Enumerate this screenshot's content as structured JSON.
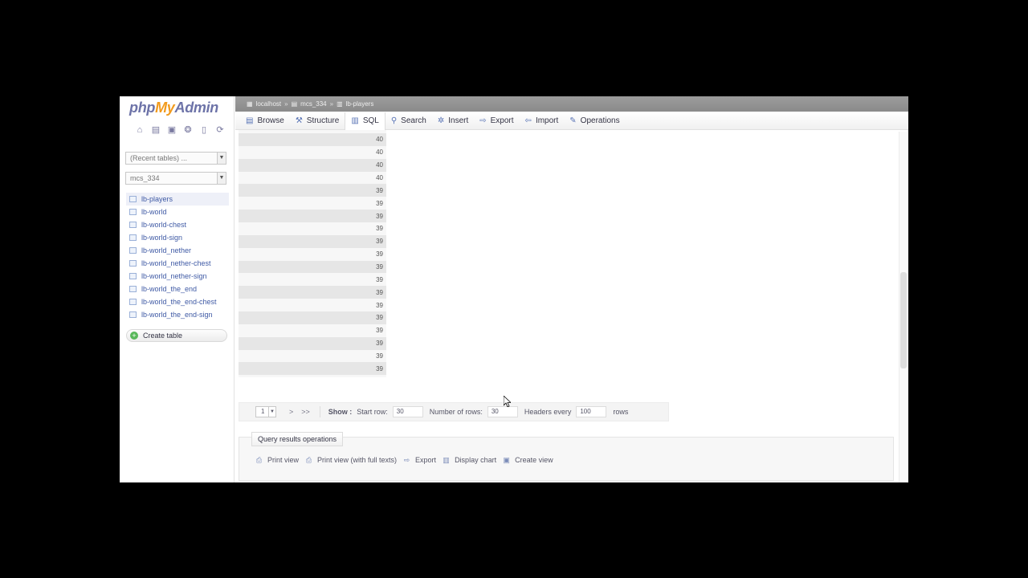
{
  "left_panel": {
    "logo": {
      "part1": "php",
      "part2": "My",
      "part3": "Admin"
    },
    "quick_icons": [
      "home-icon",
      "database-icon",
      "query-icon",
      "docs-icon",
      "copy-icon",
      "reload-icon"
    ],
    "recent_tables": "(Recent tables) ...",
    "database": "mcs_334",
    "tables": [
      "lb-players",
      "lb-world",
      "lb-world-chest",
      "lb-world-sign",
      "lb-world_nether",
      "lb-world_nether-chest",
      "lb-world_nether-sign",
      "lb-world_the_end",
      "lb-world_the_end-chest",
      "lb-world_the_end-sign"
    ],
    "create_table": "Create table"
  },
  "breadcrumb": {
    "server": "localhost",
    "database": "mcs_334",
    "table": "lb-players"
  },
  "tabs": [
    {
      "label": "Browse",
      "icon": "▤"
    },
    {
      "label": "Structure",
      "icon": "⚒"
    },
    {
      "label": "SQL",
      "icon": "▥"
    },
    {
      "label": "Search",
      "icon": "⚲"
    },
    {
      "label": "Insert",
      "icon": "✲"
    },
    {
      "label": "Export",
      "icon": "⇨"
    },
    {
      "label": "Import",
      "icon": "⇦"
    },
    {
      "label": "Operations",
      "icon": "✎"
    }
  ],
  "grid": {
    "values": [
      "40",
      "40",
      "40",
      "40",
      "39",
      "39",
      "39",
      "39",
      "39",
      "39",
      "39",
      "39",
      "39",
      "39",
      "39",
      "39",
      "39",
      "39",
      "39",
      "39"
    ]
  },
  "pagination": {
    "page": "1",
    "next": ">",
    "last": ">>",
    "show": "Show :",
    "start_row_label": "Start row:",
    "start_row": "30",
    "num_rows_label": "Number of rows:",
    "num_rows": "30",
    "headers_label": "Headers every",
    "headers_every": "100",
    "rows_suffix": "rows"
  },
  "query_ops": {
    "legend": "Query results operations",
    "links": [
      "Print view",
      "Print view (with full texts)",
      "Export",
      "Display chart",
      "Create view"
    ]
  }
}
